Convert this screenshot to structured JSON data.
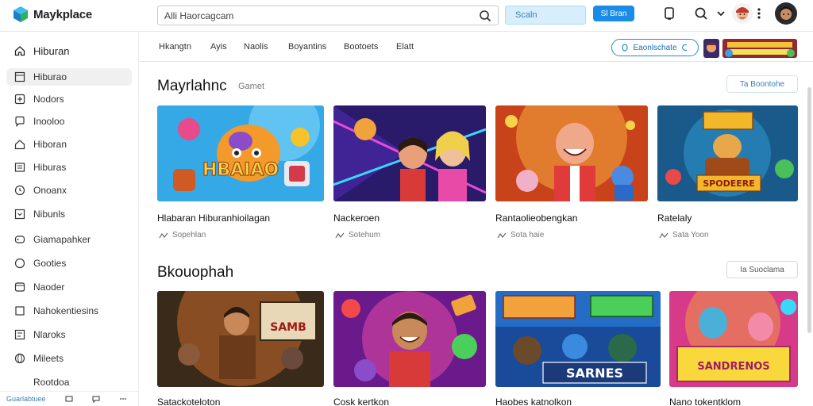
{
  "header": {
    "app_name": "Maykplace",
    "search_value": "Alli Haorcagcam",
    "filter_label": "Scaln",
    "primary_label": "Sl Bran"
  },
  "sidebar": {
    "home_label": "Hiburan",
    "items": [
      {
        "label": "Hiburao",
        "icon": "grid-icon"
      },
      {
        "label": "Nodors",
        "icon": "plus-square-icon"
      },
      {
        "label": "Inooloo",
        "icon": "chat-icon"
      },
      {
        "label": "Hiboran",
        "icon": "home-icon"
      },
      {
        "label": "Hiburas",
        "icon": "image-icon"
      },
      {
        "label": "Onoanx",
        "icon": "clock-icon"
      },
      {
        "label": "Nibunls",
        "icon": "download-icon"
      },
      {
        "label": "Giamapahker",
        "icon": "gamepad-icon"
      },
      {
        "label": "Gooties",
        "icon": "circle-icon"
      },
      {
        "label": "Naoder",
        "icon": "box-icon"
      },
      {
        "label": "Nahokentiesins",
        "icon": "square-icon"
      },
      {
        "label": "Nlaroks",
        "icon": "list-icon"
      },
      {
        "label": "Mileets",
        "icon": "globe-icon"
      },
      {
        "label": "Rootdoa",
        "icon": "none"
      }
    ],
    "bottom_label": "Guarlabtuee"
  },
  "subnav": {
    "categories": [
      "Hkangtn",
      "Ayis",
      "Naolis",
      "Boyantins",
      "Bootoets",
      "Elatt"
    ],
    "pill_label": "Eaonlschate"
  },
  "sections": [
    {
      "title": "Mayrlahnc",
      "subtitle": "Gamet",
      "button_label": "Ta Boontohe",
      "cards": [
        {
          "title": "Hlabaran Hiburanhioilagan",
          "meta": "Sopehlan",
          "art_text": "HBAIAO"
        },
        {
          "title": "Nackeroen",
          "meta": "Sotehum",
          "art_text": ""
        },
        {
          "title": "Rantaolieobengkan",
          "meta": "Sota haie",
          "art_text": ""
        },
        {
          "title": "Ratelaly",
          "meta": "Sata Yoon",
          "art_text": "SPODEERE"
        }
      ]
    },
    {
      "title": "Bkouophah",
      "subtitle": "",
      "button_label": "Ia Suoclama",
      "cards": [
        {
          "title": "Satackoteloton",
          "meta": "",
          "art_text": "SAMB"
        },
        {
          "title": "Cosk kertkon",
          "meta": "",
          "art_text": ""
        },
        {
          "title": "Haobes katnolkon",
          "meta": "",
          "art_text": "SARNES"
        },
        {
          "title": "Nano tokentklom",
          "meta": "",
          "art_text": "SANDRENOS"
        }
      ]
    }
  ],
  "colors": {
    "accent": "#1a8be6",
    "border": "#e6e6e6"
  }
}
